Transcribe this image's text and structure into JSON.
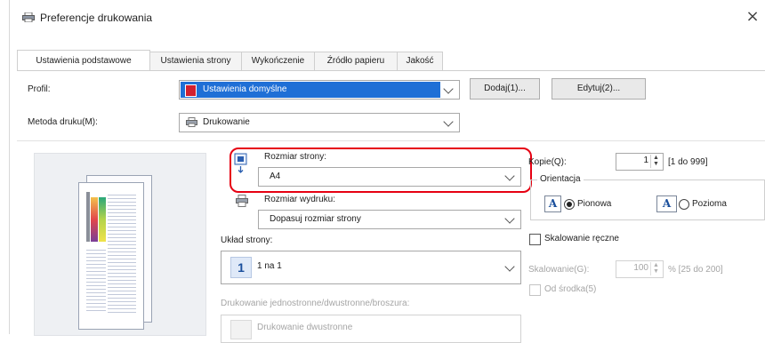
{
  "window": {
    "title": "Preferencje drukowania",
    "close_glyph": "×"
  },
  "tabs": [
    {
      "label": "Ustawienia podstawowe",
      "active": true
    },
    {
      "label": "Ustawienia strony"
    },
    {
      "label": "Wykończenie"
    },
    {
      "label": "Źródło papieru"
    },
    {
      "label": "Jakość"
    }
  ],
  "profile": {
    "label": "Profil:",
    "value": "Ustawienia domyślne",
    "add_button": "Dodaj(1)...",
    "edit_button": "Edytuj(2)..."
  },
  "print_method": {
    "label": "Metoda druku(M):",
    "value": "Drukowanie"
  },
  "page_size": {
    "label": "Rozmiar strony:",
    "value": "A4"
  },
  "output_size": {
    "label": "Rozmiar wydruku:",
    "value": "Dopasuj rozmiar strony"
  },
  "layout": {
    "label": "Układ strony:",
    "value": "1 na 1",
    "icon_number": "1"
  },
  "duplex": {
    "label": "Drukowanie jednostronne/dwustronne/broszura:",
    "value": "Drukowanie dwustronne"
  },
  "copies": {
    "label": "Kopie(Q):",
    "value": "1",
    "range": "[1 do 999]"
  },
  "orientation": {
    "group_label": "Orientacja",
    "portrait_label": "Pionowa",
    "landscape_label": "Pozioma",
    "icon_letter": "A",
    "selected": "portrait"
  },
  "manual_scaling": {
    "label": "Skalowanie ręczne",
    "checked": false,
    "scale_label": "Skalowanie(G):",
    "scale_value": "100",
    "scale_range": "% [25 do 200]",
    "from_center_label": "Od środka(5)"
  },
  "colors": {
    "highlight": "#e60012",
    "profile_icon": "#d2202f",
    "selection": "#1f6fd6"
  }
}
